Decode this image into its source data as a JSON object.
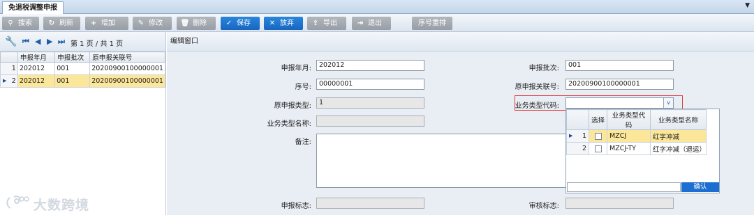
{
  "tab": {
    "title": "免退税调整申报"
  },
  "toolbar": {
    "buttons": [
      {
        "label": "搜索",
        "icon": "search-icon"
      },
      {
        "label": "刷新",
        "icon": "refresh-icon"
      },
      {
        "label": "增加",
        "icon": "plus-icon"
      },
      {
        "label": "修改",
        "icon": "edit-icon"
      },
      {
        "label": "删除",
        "icon": "trash-icon"
      },
      {
        "label": "保存",
        "icon": "check-icon"
      },
      {
        "label": "放弃",
        "icon": "close-icon"
      },
      {
        "label": "导出",
        "icon": "export-icon"
      },
      {
        "label": "退出",
        "icon": "exit-icon"
      },
      {
        "label": "序号重排",
        "icon": ""
      }
    ]
  },
  "pager": {
    "info": "第 1 页 / 共 1 页"
  },
  "grid": {
    "headers": [
      "申报年月",
      "申报批次",
      "原申报关联号"
    ],
    "rows": [
      {
        "idx": "1",
        "year_month": "202012",
        "batch": "001",
        "link_no": "20200900100000001"
      },
      {
        "idx": "2",
        "year_month": "202012",
        "batch": "001",
        "link_no": "20200900100000001"
      }
    ]
  },
  "form": {
    "header": "编辑窗口",
    "decl_month_label": "申报年月:",
    "decl_month_value": "202012",
    "decl_batch_label": "申报批次:",
    "decl_batch_value": "001",
    "seq_label": "序号:",
    "seq_value": "00000001",
    "orig_link_label": "原申报关联号:",
    "orig_link_value": "20200900100000001",
    "orig_type_label": "原申报类型:",
    "orig_type_value": "1",
    "biz_code_label": "业务类型代码:",
    "biz_code_value": "",
    "biz_name_label": "业务类型名称:",
    "biz_name_value": "",
    "remark_label": "备注:",
    "remark_value": "",
    "decl_flag_label": "申报标志:",
    "audit_flag_label": "审核标志:"
  },
  "dropdown": {
    "headers": [
      "选择",
      "业务类型代码",
      "业务类型名称"
    ],
    "rows": [
      {
        "idx": "1",
        "code": "MZCJ",
        "name": "红字冲减"
      },
      {
        "idx": "2",
        "code": "MZCJ-TY",
        "name": "红字冲减（退运）"
      }
    ],
    "confirm_label": "确认"
  },
  "watermark": {
    "text": "大数跨境"
  }
}
